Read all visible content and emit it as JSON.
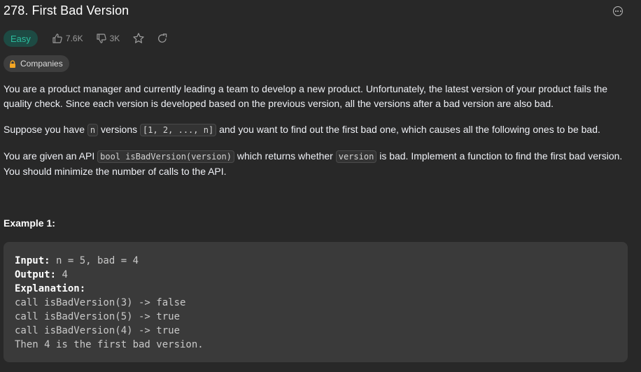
{
  "problem": {
    "title": "278. First Bad Version",
    "difficulty": "Easy",
    "likes": "7.6K",
    "dislikes": "3K",
    "companies_label": "Companies"
  },
  "description": {
    "p1": "You are a product manager and currently leading a team to develop a new product. Unfortunately, the latest version of your product fails the quality check. Since each version is developed based on the previous version, all the versions after a bad version are also bad.",
    "p2_a": "Suppose you have ",
    "p2_code1": "n",
    "p2_b": " versions ",
    "p2_code2": "[1, 2, ..., n]",
    "p2_c": " and you want to find out the first bad one, which causes all the following ones to be bad.",
    "p3_a": "You are given an API ",
    "p3_code1": "bool isBadVersion(version)",
    "p3_b": " which returns whether ",
    "p3_code2": "version",
    "p3_c": " is bad. Implement a function to find the first bad version. You should minimize the number of calls to the API."
  },
  "example": {
    "title": "Example 1:",
    "input_label": "Input:",
    "input_value": " n = 5, bad = 4",
    "output_label": "Output:",
    "output_value": " 4",
    "explanation_label": "Explanation:",
    "lines": [
      "call isBadVersion(3) -> false",
      "call isBadVersion(5) -> true",
      "call isBadVersion(4) -> true",
      "Then 4 is the first bad version."
    ]
  },
  "colors": {
    "background": "#282828",
    "easy_text": "#2cbb9d",
    "easy_bg": "#1d4a43",
    "code_block_bg": "#3a3a3a"
  },
  "icons": [
    "more-icon",
    "thumbs-up-icon",
    "thumbs-down-icon",
    "star-icon",
    "share-icon",
    "lock-icon"
  ]
}
